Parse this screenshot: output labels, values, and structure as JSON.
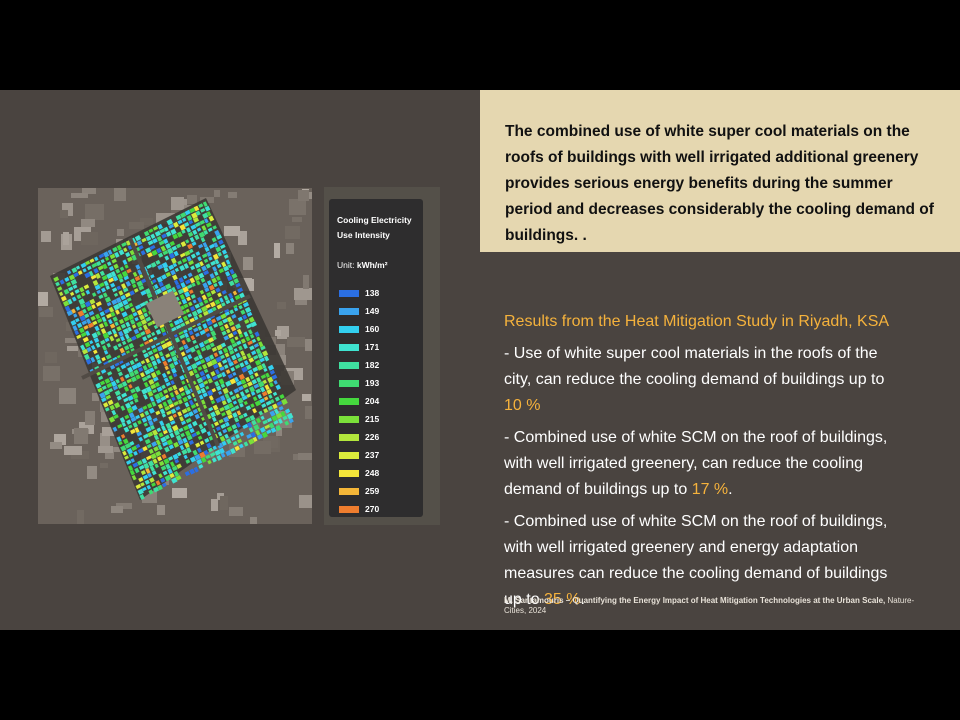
{
  "legend": {
    "title": "Cooling Electricity Use Intensity",
    "unit_label": "Unit:",
    "unit_value": "kWh/m²",
    "items": [
      {
        "value": "138",
        "color": "#2b6fe3"
      },
      {
        "value": "149",
        "color": "#3aa3ee"
      },
      {
        "value": "160",
        "color": "#33cfef"
      },
      {
        "value": "171",
        "color": "#3fe3d0"
      },
      {
        "value": "182",
        "color": "#3fe0a0"
      },
      {
        "value": "193",
        "color": "#3fdb72"
      },
      {
        "value": "204",
        "color": "#45d83e"
      },
      {
        "value": "215",
        "color": "#7be03a"
      },
      {
        "value": "226",
        "color": "#b3e63c"
      },
      {
        "value": "237",
        "color": "#dcec3c"
      },
      {
        "value": "248",
        "color": "#f4e63a"
      },
      {
        "value": "259",
        "color": "#f4b638"
      },
      {
        "value": "270",
        "color": "#ee7d2e"
      }
    ]
  },
  "callout": {
    "text": "The combined use of white super cool materials on the roofs of buildings with well irrigated additional greenery provides serious energy benefits during the summer period and decreases considerably the cooling demand of buildings. ."
  },
  "results": {
    "heading": "Results from the Heat Mitigation Study in Riyadh, KSA",
    "items": [
      {
        "text": "- Use of white super cool materials in the roofs of the city, can reduce the cooling demand of buildings up to ",
        "highlight": "10 %",
        "tail": ""
      },
      {
        "text": "- Combined use of white SCM on the roof of buildings, with well irrigated greenery, can reduce the cooling demand of buildings up to ",
        "highlight": "17 %",
        "tail": "."
      },
      {
        "text": "- Combined use of white SCM on the roof of buildings, with well irrigated greenery and energy adaptation measures can reduce the cooling demand of buildings up to ",
        "highlight": "35 %",
        "tail": "."
      }
    ]
  },
  "reference": {
    "line1_prefix": "M. Santamouris – Quantifying the Energy Impact of Heat Mitigation Technologies at the Urban Scale,",
    "line1_suffix": " Nature-",
    "line2": "Cities, 2024"
  }
}
